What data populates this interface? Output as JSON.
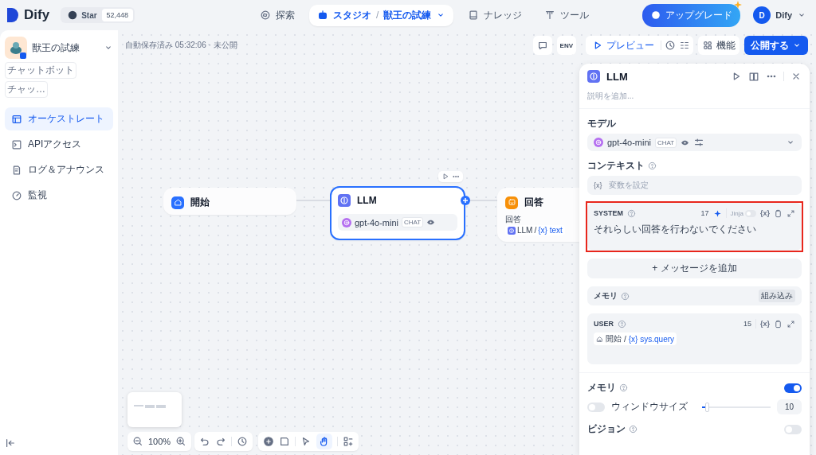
{
  "header": {
    "logo": "Dify",
    "github": {
      "label": "Star",
      "count": "52,448"
    },
    "nav": [
      {
        "label": "探索",
        "selected": false
      },
      {
        "label": "スタジオ",
        "selected": true,
        "separator": "/",
        "breadcrumb": "獣王の試練"
      },
      {
        "label": "ナレッジ",
        "selected": false
      },
      {
        "label": "ツール",
        "selected": false
      }
    ],
    "upgrade": "アップグレード",
    "user": {
      "initial": "D",
      "name": "Dify"
    }
  },
  "sidebar": {
    "app_name": "獣王の試練",
    "tags": [
      "チャットボット",
      "チャッ…"
    ],
    "items": [
      {
        "label": "オーケストレート",
        "selected": true
      },
      {
        "label": "APIアクセス",
        "selected": false
      },
      {
        "label": "ログ＆アナウンス",
        "selected": false
      },
      {
        "label": "監視",
        "selected": false
      }
    ]
  },
  "canvas": {
    "status": "自動保存済み 05:32:06 · 未公開",
    "env": "ENV",
    "preview": "プレビュー",
    "features": "機能",
    "publish": "公開する",
    "nodes": [
      {
        "kind": "start",
        "title": "開始",
        "selected": false
      },
      {
        "kind": "llm",
        "title": "LLM",
        "model": "gpt-4o-mini",
        "badge": "CHAT",
        "selected": true
      },
      {
        "kind": "answer",
        "title": "回答",
        "field": "回答",
        "source": "LLM",
        "separator": "/",
        "var_mark": "{x}",
        "variable": "text",
        "selected": false
      }
    ],
    "zoom": "100%"
  },
  "panel": {
    "title": "LLM",
    "description_placeholder": "説明を追加...",
    "model": {
      "label": "モデル",
      "name": "gpt-4o-mini",
      "badge": "CHAT"
    },
    "context": {
      "label": "コンテキスト",
      "var_mark": "{x}",
      "placeholder": "変数を設定"
    },
    "system": {
      "label": "SYSTEM",
      "count": "17",
      "jinja": {
        "label": "Jinja",
        "on": false
      },
      "var_mark": "{x}",
      "text": "それらしい回答を行わないでください",
      "highlighted": true
    },
    "add_message": "+ メッセージを追加",
    "memory_role": {
      "label": "メモリ",
      "value": "組み込み"
    },
    "user": {
      "label": "USER",
      "count": "15",
      "var_mark": "{x}",
      "source": "開始",
      "separator": "/",
      "ref_mark": "{x}",
      "variable": "sys.query"
    },
    "memory": {
      "label": "メモリ",
      "on": true
    },
    "window_size": {
      "label": "ウィンドウサイズ",
      "checked": false,
      "level": 0.05,
      "value": "10"
    },
    "vision": {
      "label": "ビジョン",
      "on": false
    }
  }
}
